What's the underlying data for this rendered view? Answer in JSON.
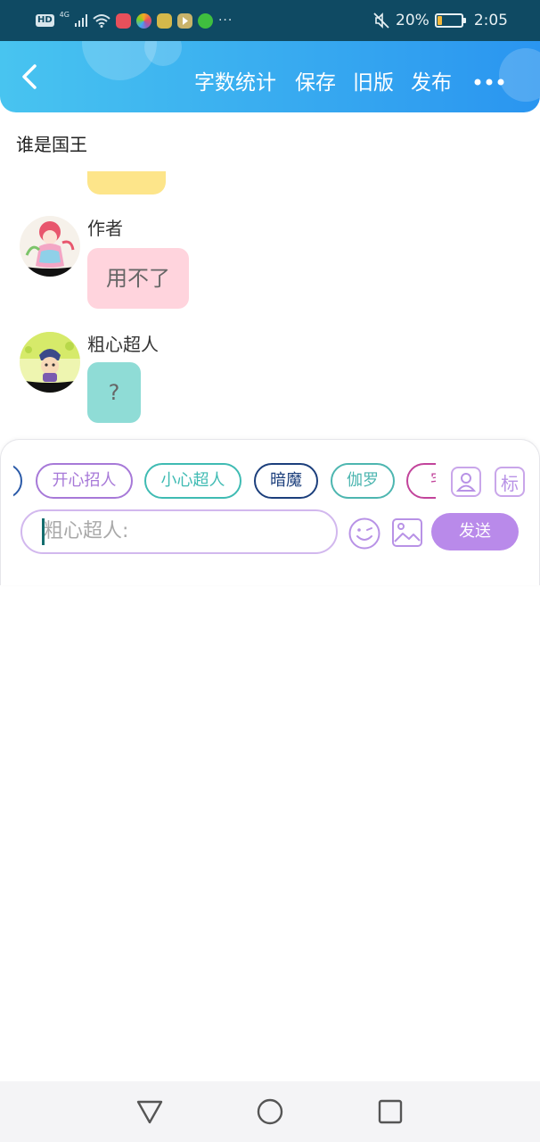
{
  "status_bar": {
    "signal_type": "4G",
    "hd_label": "HD",
    "battery_percent": "20%",
    "battery_level": 0.2,
    "time": "2:05",
    "more_indicator": "···",
    "icons": [
      "hd-icon",
      "signal-icon",
      "wifi-icon",
      "app-icon-red",
      "app-icon-colorful",
      "app-icon-yellow",
      "app-icon-play",
      "app-icon-iqiyi",
      "mute-icon",
      "battery-icon"
    ]
  },
  "header": {
    "background_start": "#48c4f0",
    "background_end": "#2a95f0",
    "back_icon": "chevron-left-icon",
    "actions": {
      "word_count": "字数统计",
      "save": "保存",
      "old_version": "旧版",
      "publish": "发布"
    },
    "more_icon": "more-icon"
  },
  "chat": {
    "title": "谁是国王",
    "messages": [
      {
        "sender": "作者",
        "text": "用不了",
        "bubble_color": "#ffd4dd",
        "avatar": "avatar-author-icon"
      },
      {
        "sender": "粗心超人",
        "text": "?",
        "bubble_color": "#8fdcd6",
        "avatar": "avatar-careless-superman-icon"
      }
    ]
  },
  "input_panel": {
    "characters": [
      {
        "name": "",
        "color": "#2b5aa8"
      },
      {
        "name": "开心招人",
        "color": "#a779d8"
      },
      {
        "name": "小心超人",
        "color": "#3fbbb3"
      },
      {
        "name": "暗魔",
        "color": "#1c3f7c"
      },
      {
        "name": "伽罗",
        "color": "#4db6b0"
      },
      {
        "name": "宅",
        "color": "#c2449b"
      }
    ],
    "role_icon": "user-card-icon",
    "tag_label": "标",
    "placeholder": "粗心超人:",
    "emoji_icon": "smiley-icon",
    "image_icon": "image-icon",
    "send_label": "发送",
    "accent_color": "#b98aea"
  },
  "nav_bar": {
    "icons": [
      "back-triangle-icon",
      "home-circle-icon",
      "recents-square-icon"
    ]
  }
}
